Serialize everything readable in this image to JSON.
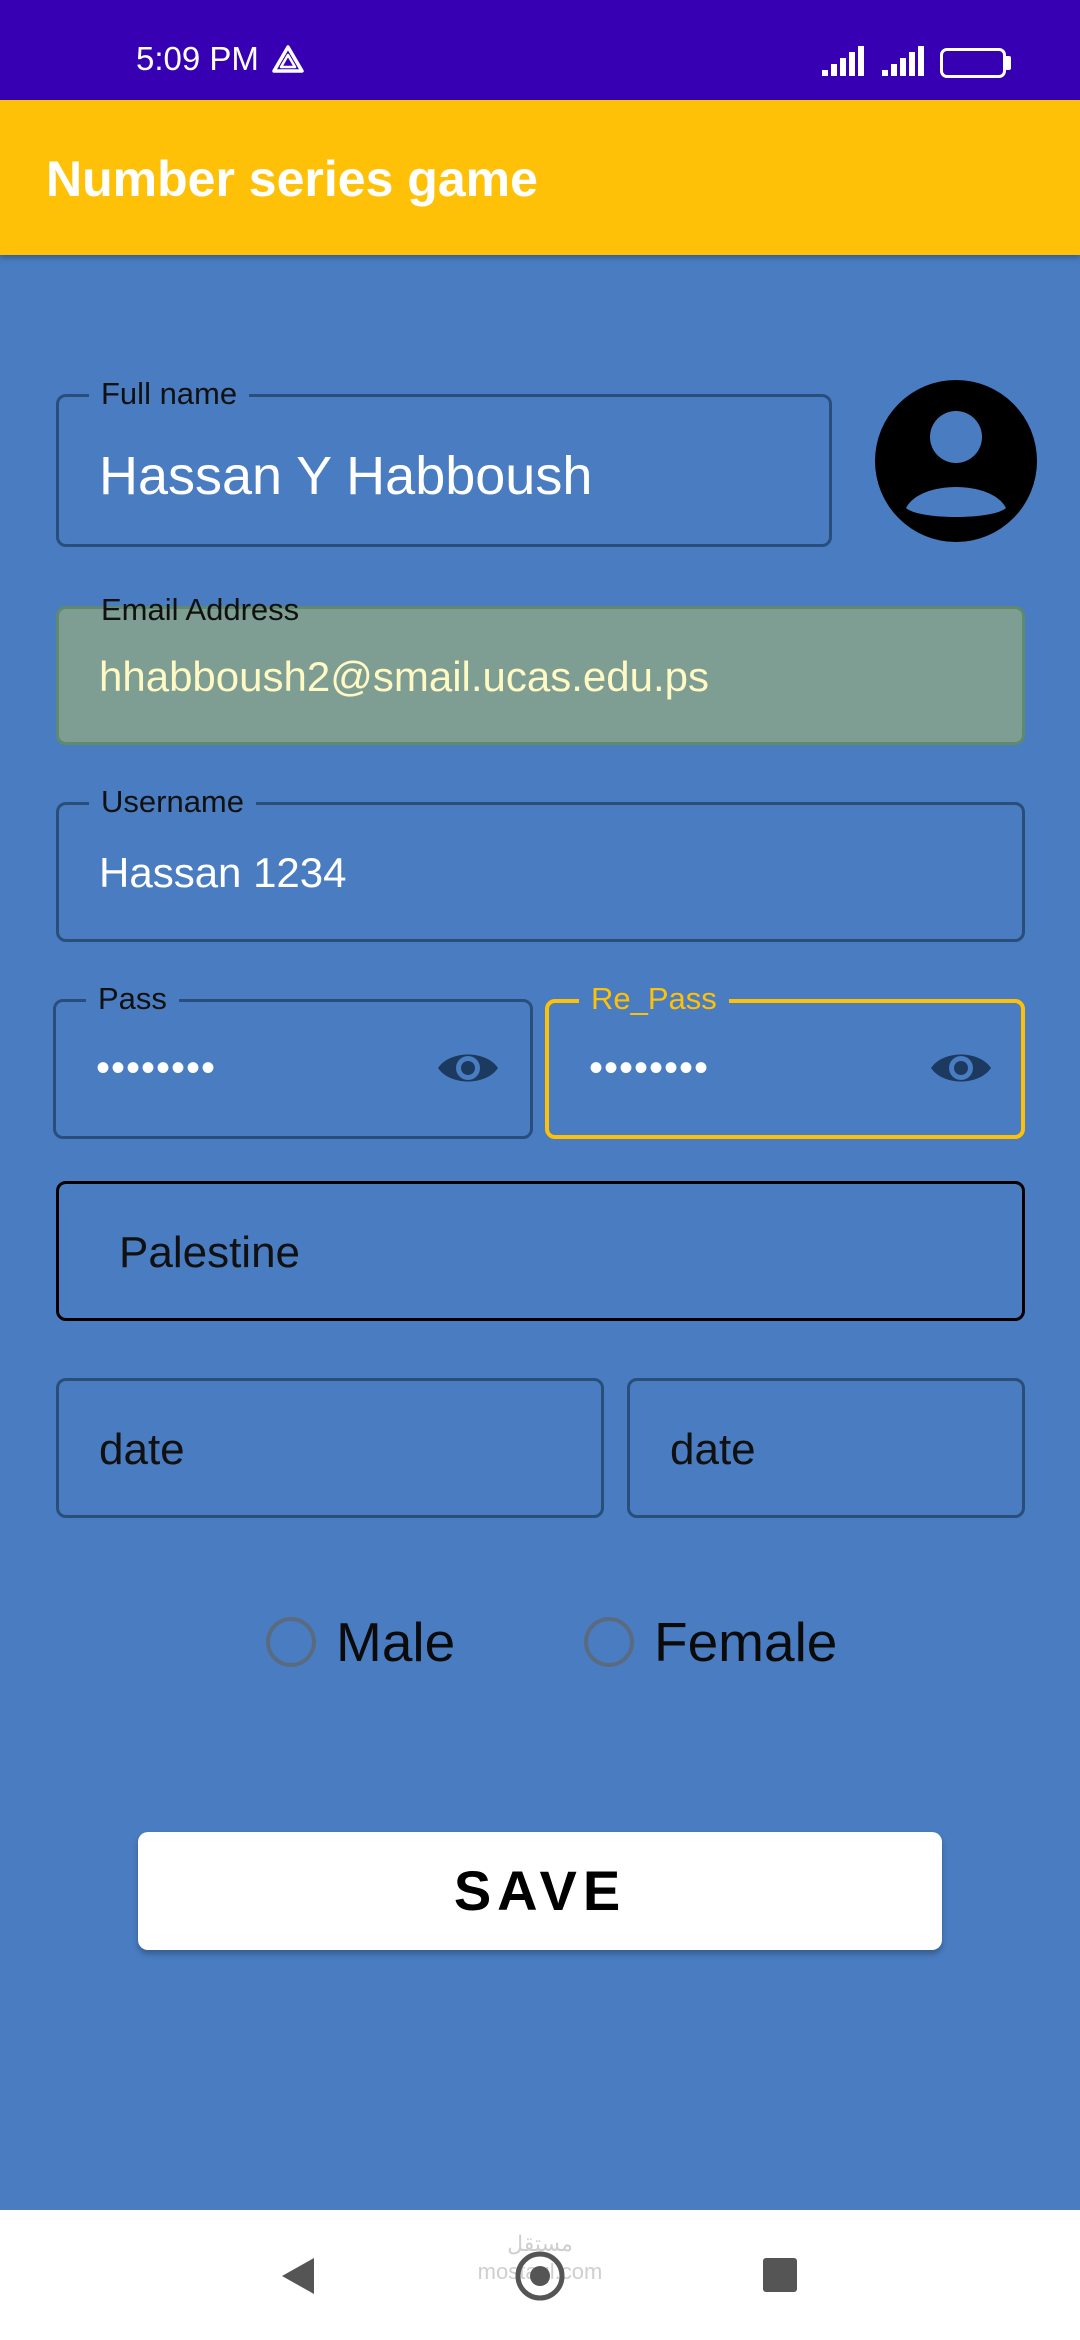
{
  "status_bar": {
    "time": "5:09 PM",
    "battery": "22",
    "battery_level": 0.22,
    "icons": [
      "drive-icon",
      "signal-icon",
      "signal-icon",
      "battery-icon"
    ]
  },
  "app_bar": {
    "title": "Number series game",
    "color": "#FFC107"
  },
  "form": {
    "full_name": {
      "label": "Full name",
      "value": "Hassan Y Habboush"
    },
    "email": {
      "label": "Email Address",
      "value": "hhabboush2@smail.ucas.edu.ps"
    },
    "username": {
      "label": "Username",
      "value": "Hassan 1234"
    },
    "pass": {
      "label": "Pass",
      "value": "••••••••"
    },
    "re_pass": {
      "label": "Re_Pass",
      "value": "••••••••"
    },
    "country": {
      "value": "Palestine"
    },
    "date_1": {
      "placeholder": "date"
    },
    "date_2": {
      "placeholder": "date"
    },
    "gender": {
      "options": [
        "Male",
        "Female"
      ],
      "selected": null
    },
    "save_label": "SAVE"
  },
  "colors": {
    "background": "#497CC0",
    "status_bar": "#3700B3",
    "focus_accent": "#FFC107",
    "email_fill": "#7E9E93",
    "email_text": "#FFF9C4"
  },
  "nav_bar": {
    "icons": [
      "back-icon",
      "home-icon",
      "recents-icon"
    ],
    "watermark": "مستقل mostaql.com"
  }
}
